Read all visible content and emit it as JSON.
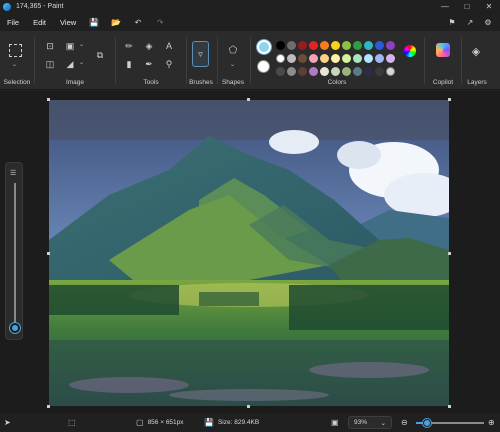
{
  "window": {
    "title": "174,365 - Paint",
    "controls": [
      "minimize-icon",
      "maximize-icon",
      "close-icon"
    ]
  },
  "menu": {
    "items": [
      "File",
      "Edit",
      "View"
    ],
    "quick_icons": [
      "save-icon",
      "open-icon",
      "undo-icon",
      "redo-icon"
    ],
    "right_icons": [
      "feedback-icon",
      "share-icon",
      "settings-icon"
    ]
  },
  "ribbon": {
    "groups": {
      "selection": "Selection",
      "image": "Image",
      "tools": "Tools",
      "brushes": "Brushes",
      "shapes": "Shapes",
      "colors": "Colors",
      "copilot": "Copilot",
      "layers": "Layers"
    },
    "current_color_1": "#8fd3f0",
    "current_color_2": "#ffffff",
    "palette": [
      "#000000",
      "#6e6e6e",
      "#9b1c1c",
      "#e02424",
      "#f57c1f",
      "#f8d21b",
      "#8bc34a",
      "#2e9e46",
      "#2fb6c9",
      "#2a5cd6",
      "#8e3fc2",
      "#ffffff",
      "#bdbdbd",
      "#6d4c3a",
      "#f4a3b8",
      "#ffd08a",
      "#fff1a8",
      "#d4f0a0",
      "#a8e6c0",
      "#b4e4ff",
      "#9fb7f0",
      "#d1b3f0",
      "#4a4a4a",
      "#8c8c8c",
      "#5c4033",
      "#b07ac0",
      "#e9e4d6",
      "#c9d5b8",
      "#9ab57a",
      "#5a7a8c",
      "#2c2c4a",
      "#3a3a3a",
      "#d8d8d8"
    ]
  },
  "status": {
    "dimensions": "856 × 651px",
    "size": "Size: 829.4KB",
    "zoom": "93%"
  },
  "zoom_level_fraction": 0.93
}
